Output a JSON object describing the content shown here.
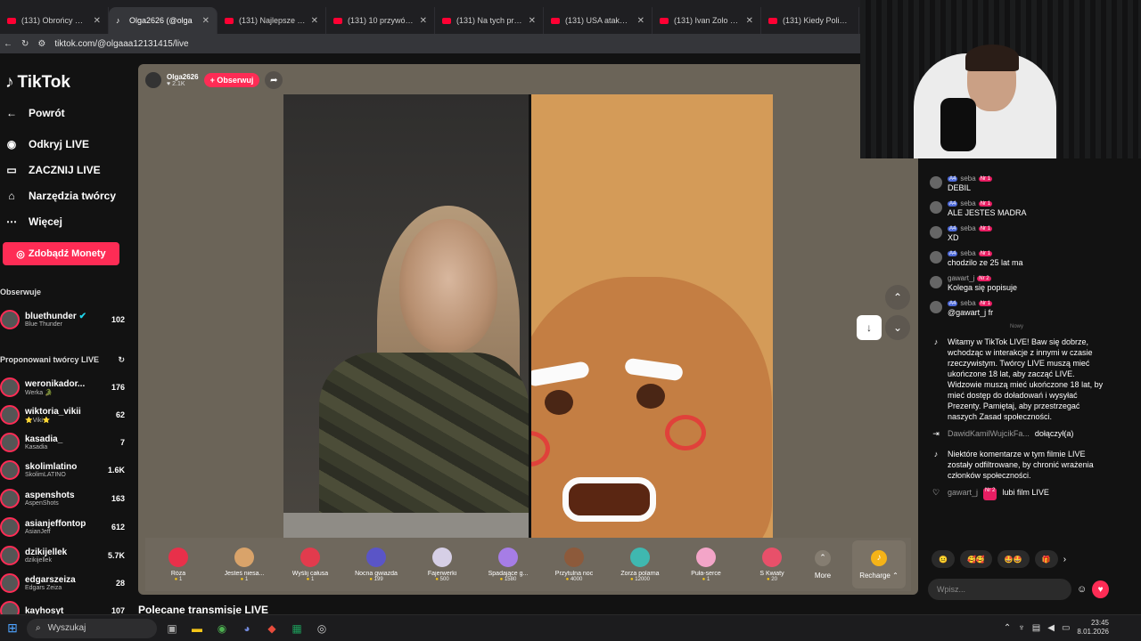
{
  "browser": {
    "tabs": [
      {
        "icon": "youtube-icon",
        "title": "(131) Obrońcy Wene",
        "active": false
      },
      {
        "icon": "tiktok-icon",
        "title": "Olga2626 (@olga",
        "active": true
      },
      {
        "icon": "youtube-icon",
        "title": "(131) Najlepsze Tekst",
        "active": false
      },
      {
        "icon": "youtube-icon",
        "title": "(131) 10 przywódców",
        "active": false
      },
      {
        "icon": "youtube-icon",
        "title": "(131) Na tych przedm",
        "active": false
      },
      {
        "icon": "youtube-icon",
        "title": "(131) USA atakuje We",
        "active": false
      },
      {
        "icon": "youtube-icon",
        "title": "(131) Ivan Zolo Był le",
        "active": false
      },
      {
        "icon": "youtube-icon",
        "title": "(131) Kiedy Policjanc",
        "active": false
      }
    ],
    "url": "tiktok.com/@olgaaa12131415/live"
  },
  "sidebar": {
    "logo": "TikTok",
    "nav": [
      {
        "icon": "back-arrow-icon",
        "label": "Powrót"
      },
      {
        "icon": "live-icon",
        "label": "Odkryj LIVE"
      },
      {
        "icon": "camera-icon",
        "label": "ZACZNIJ LIVE"
      },
      {
        "icon": "house-icon",
        "label": "Narzędzia twórcy"
      },
      {
        "icon": "more-dots-icon",
        "label": "Więcej"
      }
    ],
    "coins_button": "Zdobądź Monety",
    "following_title": "Obserwuje",
    "following": [
      {
        "name": "bluethunder",
        "sub": "Blue Thunder",
        "count": "102",
        "verified": true
      }
    ],
    "suggested_title": "Proponowani twórcy LIVE",
    "suggested": [
      {
        "name": "weronikador...",
        "sub": "Werka 🐊",
        "count": "176"
      },
      {
        "name": "wiktoria_vikii",
        "sub": "⭐Viki⭐",
        "count": "62"
      },
      {
        "name": "kasadia_",
        "sub": "Kasadia",
        "count": "7"
      },
      {
        "name": "skolimlatino",
        "sub": "SkolimLATINO",
        "count": "1.6K"
      },
      {
        "name": "aspenshots",
        "sub": "AspenShots",
        "count": "163"
      },
      {
        "name": "asianjeffontop",
        "sub": "AsianJeff",
        "count": "612"
      },
      {
        "name": "dzikijellek",
        "sub": "dzikijellek",
        "count": "5.7K"
      },
      {
        "name": "edgarszeiza",
        "sub": "Edgars Zeiza",
        "count": "28"
      },
      {
        "name": "kayhosyt",
        "sub": "",
        "count": "107"
      }
    ]
  },
  "stream": {
    "host_name": "Olga2626",
    "host_likes": "♥ 2.1K",
    "follow_label": "+ Obserwuj",
    "gifts": [
      {
        "name": "Róża",
        "price": "1",
        "color": "#e8304a"
      },
      {
        "name": "Jesteś niesa...",
        "price": "1",
        "color": "#d9a36a"
      },
      {
        "name": "Wyślij całusa",
        "price": "1",
        "color": "#e23b4d"
      },
      {
        "name": "Nocna gwiazda",
        "price": "199",
        "color": "#5a55c7"
      },
      {
        "name": "Fajerwerki",
        "price": "500",
        "color": "#d6cfe6"
      },
      {
        "name": "Spadające g...",
        "price": "1580",
        "color": "#a67de6"
      },
      {
        "name": "Przytulna noc",
        "price": "4000",
        "color": "#8d5a3b"
      },
      {
        "name": "Zorza polarna",
        "price": "12000",
        "color": "#3fb8b0"
      },
      {
        "name": "Puła-serce",
        "price": "1",
        "color": "#f3a5c8"
      },
      {
        "name": "S Kwiaty",
        "price": "20",
        "color": "#e8506a"
      }
    ],
    "more_label": "More",
    "recharge_label": "Recharge ⌃"
  },
  "recommended_title": "Polecane transmisje LIVE",
  "chat": {
    "messages": [
      {
        "level": "A4",
        "user": "seba",
        "badge": "Nr 1",
        "text": "DEBIL"
      },
      {
        "level": "A4",
        "user": "seba",
        "badge": "Nr 1",
        "text": "ALE JESTES MADRA"
      },
      {
        "level": "A4",
        "user": "seba",
        "badge": "Nr 1",
        "text": "XD"
      },
      {
        "level": "A4",
        "user": "seba",
        "badge": "Nr 1",
        "text": "chodzilo ze 25 lat ma"
      },
      {
        "level": "",
        "user": "gawart_j",
        "badge": "Nr 2",
        "text": "Kolega się popisuje"
      },
      {
        "level": "A4",
        "user": "seba",
        "badge": "Nr 1",
        "text": "@gawart_j fr"
      }
    ],
    "new_label": "Nowy",
    "system_welcome": "Witamy w TikTok LIVE! Baw się dobrze, wchodząc w interakcje z innymi w czasie rzeczywistym. Twórcy LIVE muszą mieć ukończone 18 lat, aby zacząć LIVE. Widzowie muszą mieć ukończone 18 lat, by mieć dostęp do doładowań i wysyłać Prezenty. Pamiętaj, aby przestrzegać naszych Zasad społeczności.",
    "joined_user": "DawidKamilWujcikFa...",
    "joined_text": "dołączył(a)",
    "filter_notice": "Niektóre komentarze w tym filmie LIVE zostały odfiltrowane, by chronić wrażenia członków społeczności.",
    "last_user": "gawart_j",
    "last_badge": "Nr 2",
    "last_text": "lubi film LIVE",
    "emojis": [
      "😐",
      "🥰🥰",
      "🤩🤩",
      "🎁"
    ],
    "input_placeholder": "Wpisz..."
  },
  "taskbar": {
    "search_label": "Wyszukaj",
    "time": "23:45",
    "date": "8.01.2026"
  }
}
